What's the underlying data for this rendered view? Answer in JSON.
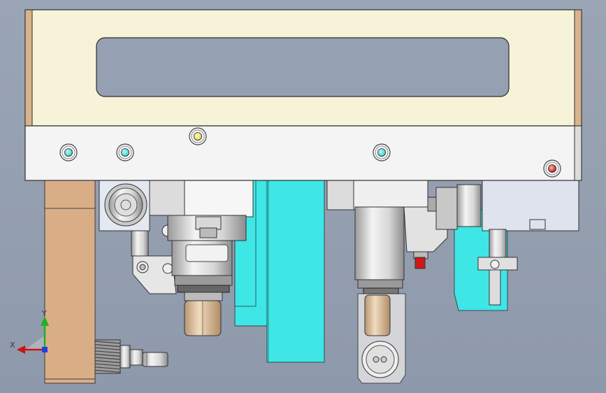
{
  "view": {
    "background_top": "#9aa5b5",
    "background_bottom": "#8e99ab"
  },
  "colors": {
    "plate_cream": "#f7f3d9",
    "plate_white": "#f4f4f4",
    "wood": "#d9ae87",
    "cyan": "#3fe6e6",
    "metal_light": "#e6e6e6",
    "metal_mid": "#c9c9c9",
    "metal_dark": "#8a8a8a",
    "brass": "#d8b892",
    "outline": "#3a3a3a",
    "slot": "#95a0b2",
    "block_blue": "#dfe3ee",
    "dot_cyan": "#35d6d6",
    "dot_yellow": "#f0e040",
    "dot_red": "#d01818",
    "axis_green": "#20b020",
    "axis_red": "#d01010",
    "axis_blue": "#2040e0"
  },
  "triad": {
    "x_label": "X",
    "y_label": "Y"
  },
  "icons": {
    "triad": "coordinate-triad-icon",
    "indicator": "indicator-dot-icon"
  }
}
